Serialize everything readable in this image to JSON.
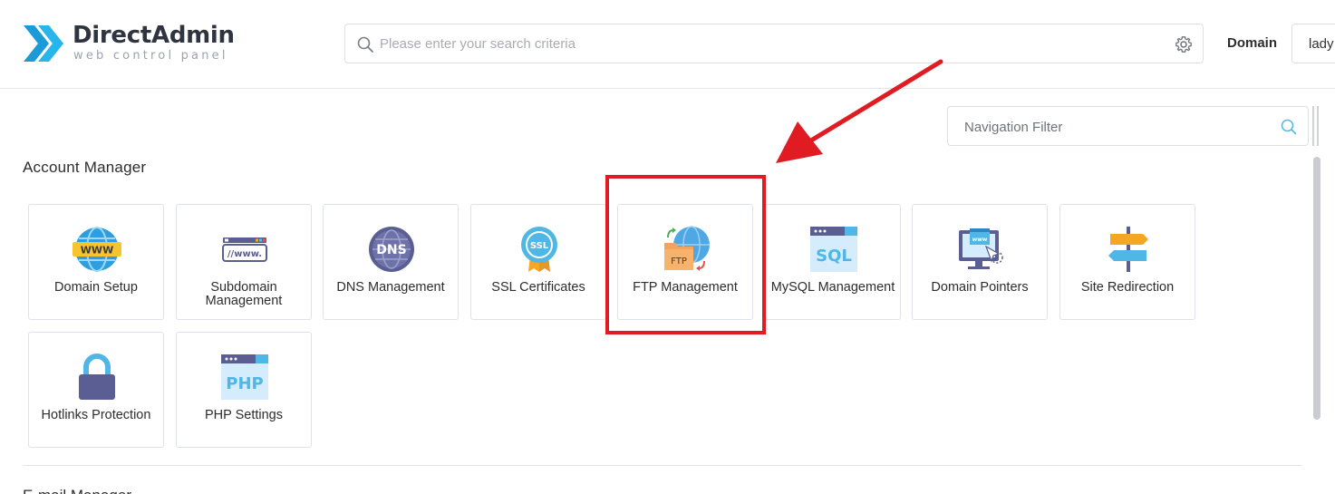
{
  "brand": {
    "title": "DirectAdmin",
    "subtitle": "web control panel",
    "colors": {
      "primary": "#1a9ad6",
      "dark": "#2f3540"
    }
  },
  "header": {
    "search_placeholder": "Please enter your search criteria",
    "search_icon": "search-icon",
    "settings_icon": "gear-icon",
    "domain_label": "Domain",
    "domain_value": "lady"
  },
  "nav_filter": {
    "placeholder": "Navigation Filter",
    "icon": "search-icon"
  },
  "sections": {
    "account_manager": {
      "title": "Account Manager",
      "items": [
        {
          "label": "Domain Setup",
          "icon": "www-globe-icon"
        },
        {
          "label": "Subdomain Management",
          "icon": "subdomain-icon"
        },
        {
          "label": "DNS Management",
          "icon": "dns-globe-icon"
        },
        {
          "label": "SSL Certificates",
          "icon": "ssl-badge-icon"
        },
        {
          "label": "FTP Management",
          "icon": "ftp-folder-icon"
        },
        {
          "label": "MySQL Management",
          "icon": "sql-window-icon"
        },
        {
          "label": "Domain Pointers",
          "icon": "domain-pointer-monitor-icon"
        },
        {
          "label": "Site Redirection",
          "icon": "signpost-icon"
        },
        {
          "label": "Hotlinks Protection",
          "icon": "padlock-icon"
        },
        {
          "label": "PHP Settings",
          "icon": "php-window-icon"
        }
      ]
    },
    "next": {
      "title": "E-mail Manager"
    }
  },
  "annotation": {
    "highlight_color": "#e01b22",
    "highlighted_item": "FTP Management"
  }
}
